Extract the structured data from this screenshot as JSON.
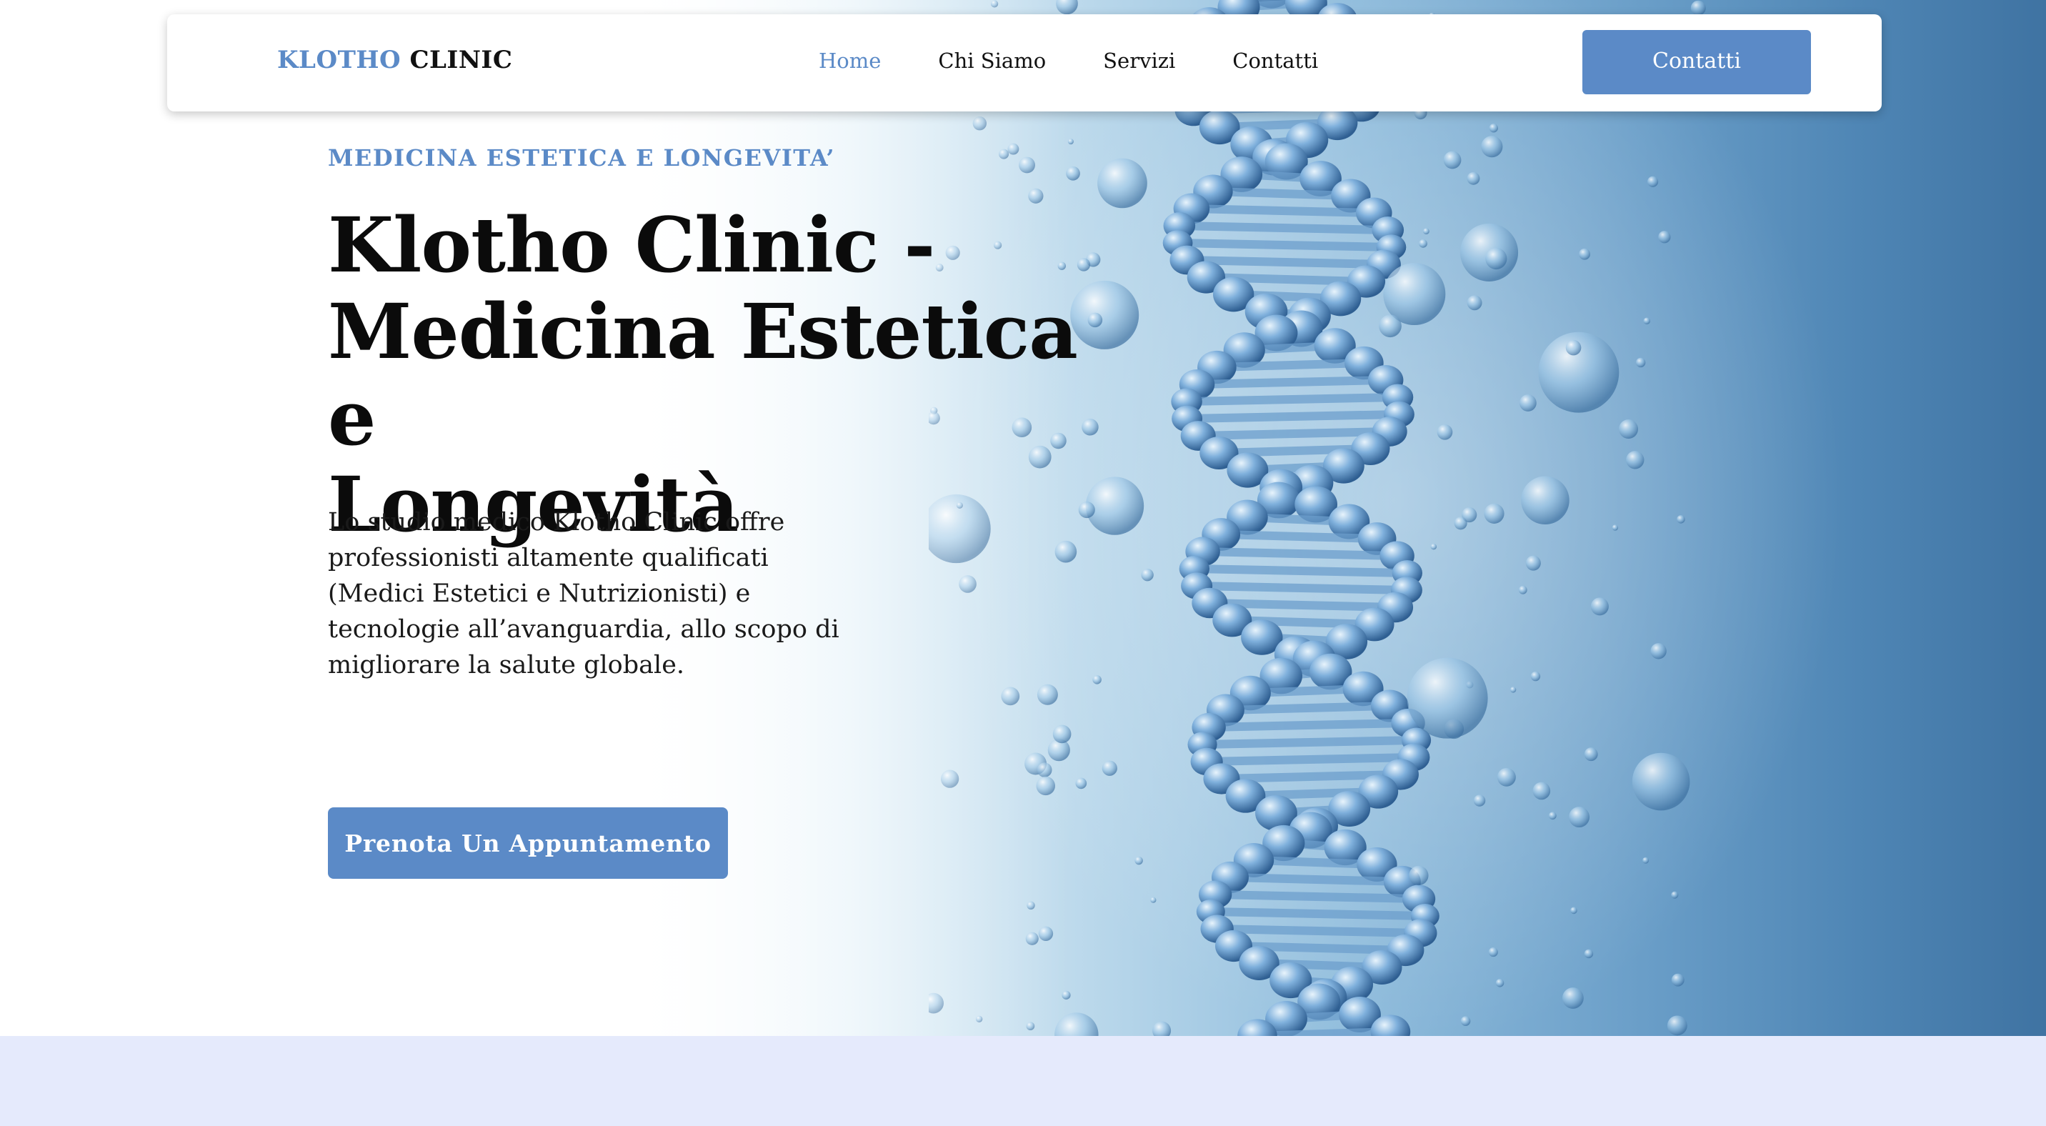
{
  "nav": {
    "logo_part1": "KLOTHO",
    "logo_part2": "CLINIC",
    "links": [
      {
        "label": "Home",
        "active": true
      },
      {
        "label": "Chi Siamo",
        "active": false
      },
      {
        "label": "Servizi",
        "active": false
      },
      {
        "label": "Contatti",
        "active": false
      }
    ],
    "cta_label": "Contatti"
  },
  "hero": {
    "eyebrow": "MEDICINA ESTETICA E LONGEVITA’",
    "headline_line1": "Klotho Clinic -",
    "headline_line2": "Medicina Estetica e",
    "headline_line3": "Longevità",
    "intro": "Lo studio medico Klotho Clinic offre professionisti altamente qualificati (Medici Estetici e Nutrizionisti) e tecnologie all’avanguardia, allo scopo di migliorare la salute globale.",
    "cta_label": "Prenota Un Appuntamento",
    "image": "dna-double-helix-water-bubbles"
  },
  "colors": {
    "accent": "#5b8ac7",
    "text": "#111111",
    "footer_band": "#e5eafc"
  }
}
